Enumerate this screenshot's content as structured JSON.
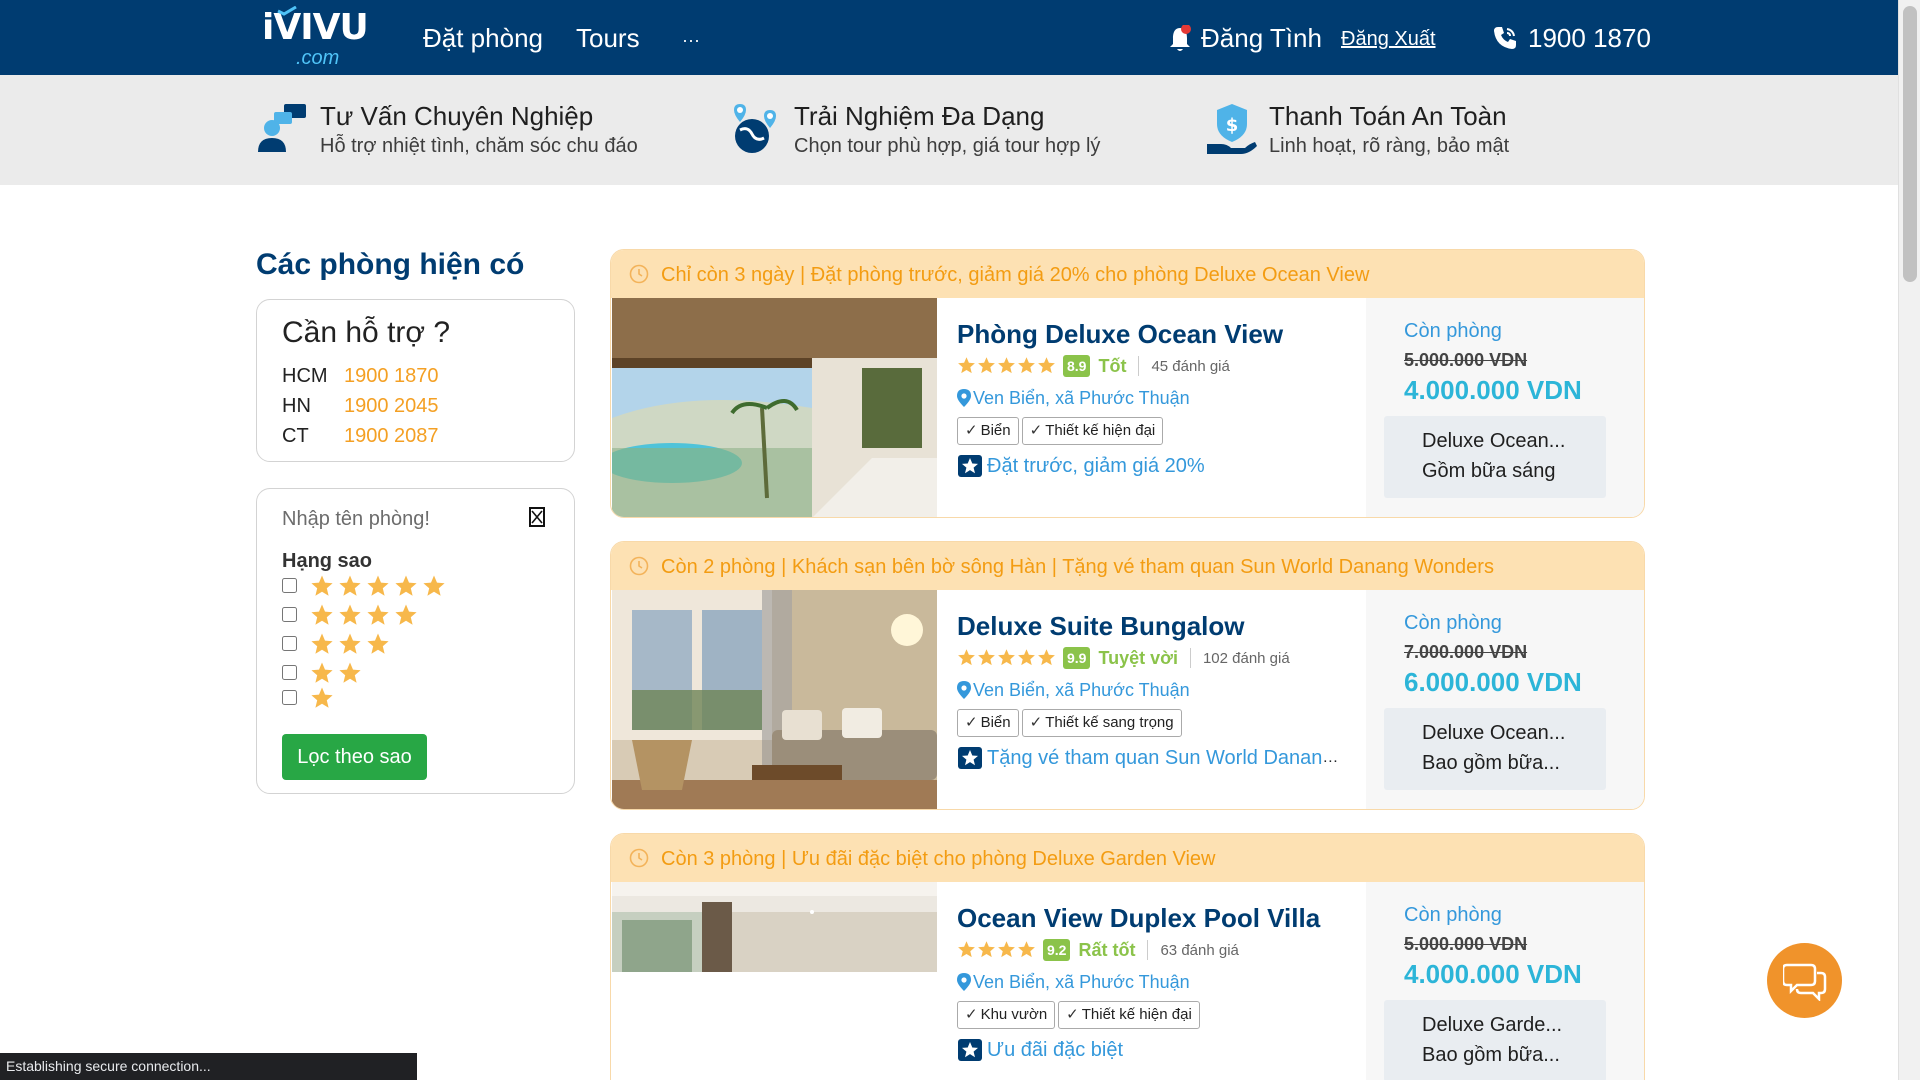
{
  "header": {
    "logo_text": "iVIVU",
    "logo_domain": ".com",
    "nav": [
      "Đặt phòng",
      "Tours",
      "···"
    ],
    "username": "Đăng Tình",
    "logout": "Đăng Xuất",
    "hotline": "1900 1870"
  },
  "features": [
    {
      "title": "Tư Vấn Chuyên Nghiệp",
      "subtitle": "Hỗ trợ nhiệt tình, chăm sóc chu đáo",
      "icon": "consultant-icon"
    },
    {
      "title": "Trải Nghiệm Đa Dạng",
      "subtitle": "Chọn tour phù hợp, giá tour hợp lý",
      "icon": "globe-pin-icon"
    },
    {
      "title": "Thanh Toán An Toàn",
      "subtitle": "Linh hoạt, rõ ràng, bảo mật",
      "icon": "secure-payment-icon"
    }
  ],
  "sidebar": {
    "title": "Các phòng hiện có",
    "support": {
      "title": "Cần hỗ trợ ?",
      "rows": [
        {
          "city": "HCM",
          "phone": "1900 1870"
        },
        {
          "city": "HN",
          "phone": "1900 2045"
        },
        {
          "city": "CT",
          "phone": "1900 2087"
        }
      ]
    },
    "filter": {
      "search_placeholder": "Nhập tên phòng!",
      "rank_label": "Hạng sao",
      "star_options": [
        5,
        4,
        3,
        2,
        1
      ],
      "button": "Lọc theo sao"
    }
  },
  "rooms": [
    {
      "banner": "Chỉ còn 3 ngày | Đặt phòng trước, giảm giá 20% cho phòng Deluxe Ocean View",
      "name": "Phòng Deluxe Ocean View",
      "stars": 5,
      "score": "8.9",
      "score_text": "Tốt",
      "reviews": "45 đánh giá",
      "location": "Ven Biển, xã Phước Thuận",
      "tags": [
        "Biển",
        "Thiết kế hiện đại"
      ],
      "promo": "Đặt trước, giảm giá 20%",
      "availability": "Còn phòng",
      "old_price": "5.000.000 VDN",
      "new_price": "4.000.000 VDN",
      "package_line1": "Deluxe Ocean...",
      "package_line2": "Gồm bữa sáng"
    },
    {
      "banner": "Còn 2 phòng | Khách sạn bên bờ sông Hàn | Tặng vé tham quan Sun World Danang Wonders",
      "name": "Deluxe Suite Bungalow",
      "stars": 5,
      "score": "9.9",
      "score_text": "Tuyệt vời",
      "reviews": "102 đánh giá",
      "location": "Ven Biển, xã Phước Thuận",
      "tags": [
        "Biển",
        "Thiết kế sang trọng"
      ],
      "promo": "Tặng vé tham quan Sun World Danang...",
      "availability": "Còn phòng",
      "old_price": "7.000.000 VDN",
      "new_price": "6.000.000 VDN",
      "package_line1": "Deluxe Ocean...",
      "package_line2": "Bao gồm bữa..."
    },
    {
      "banner": "Còn 3 phòng | Ưu đãi đặc biệt cho phòng Deluxe Garden View",
      "name": "Ocean View Duplex Pool Villa",
      "stars": 4,
      "score": "9.2",
      "score_text": "Rất tốt",
      "reviews": "63 đánh giá",
      "location": "Ven Biển, xã Phước Thuận",
      "tags": [
        "Khu vườn",
        "Thiết kế hiện đại"
      ],
      "promo": "Ưu đãi đặc biệt",
      "availability": "Còn phòng",
      "old_price": "5.000.000 VDN",
      "new_price": "4.000.000 VDN",
      "package_line1": "Deluxe Garde...",
      "package_line2": "Bao gồm bữa..."
    }
  ],
  "status_bar": "Establishing secure connection...",
  "colors": {
    "header_bg": "#003c71",
    "accent_orange": "#f4a024",
    "banner_bg": "#fde1b3",
    "price_blue": "#2cb5d8",
    "score_green": "#8bc34a",
    "button_green": "#28a745"
  }
}
